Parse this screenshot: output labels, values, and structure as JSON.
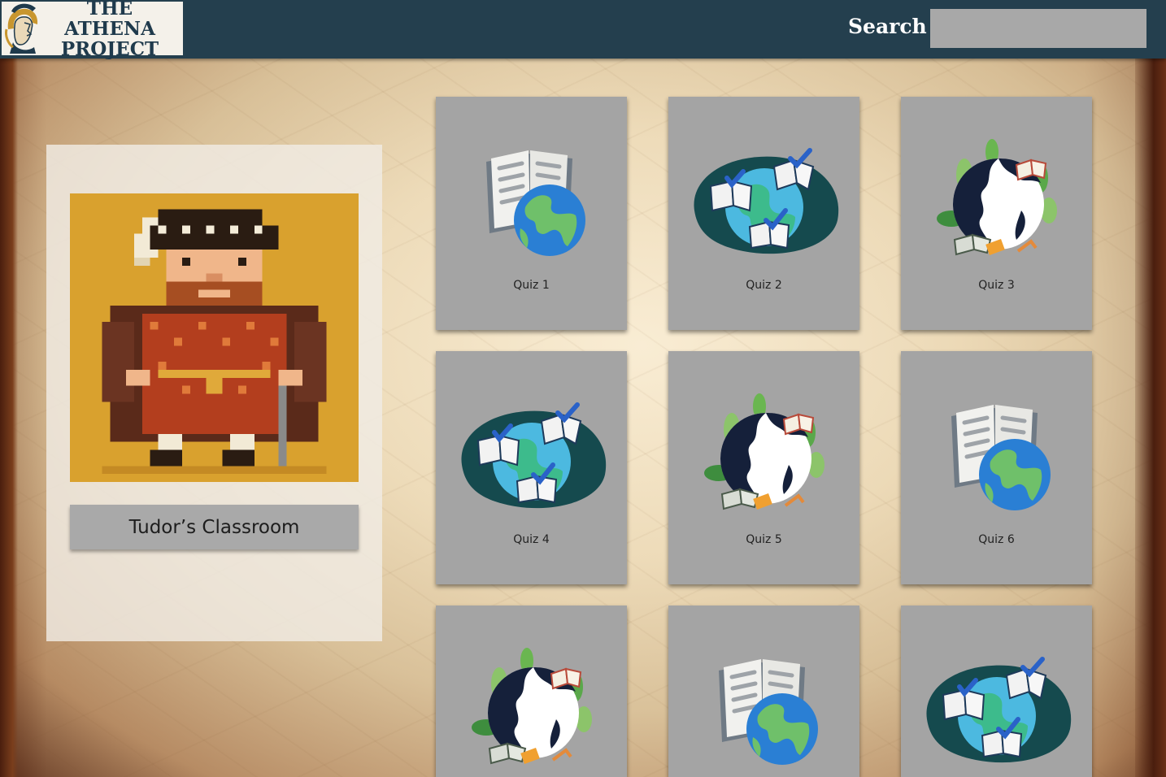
{
  "header": {
    "logo_line1": "THE ATHENA",
    "logo_line2": "PROJECT",
    "search_label": "Search",
    "search_value": "",
    "search_placeholder": "",
    "bar_color": "#243f4e"
  },
  "profile": {
    "classroom_label": "Tudor’s Classroom",
    "avatar_icon": "tudor-king-pixel-avatar"
  },
  "quizzes": [
    {
      "label": "Quiz 1",
      "icon": "book-globe-icon"
    },
    {
      "label": "Quiz 2",
      "icon": "globe-checked-books-icon"
    },
    {
      "label": "Quiz 3",
      "icon": "earth-plants-books-icon"
    },
    {
      "label": "Quiz 4",
      "icon": "globe-checked-books-icon"
    },
    {
      "label": "Quiz 5",
      "icon": "earth-plants-books-icon"
    },
    {
      "label": "Quiz 6",
      "icon": "book-globe-icon"
    },
    {
      "label": "",
      "icon": "earth-plants-books-icon"
    },
    {
      "label": "",
      "icon": "book-globe-icon"
    },
    {
      "label": "",
      "icon": "globe-checked-books-icon"
    }
  ]
}
